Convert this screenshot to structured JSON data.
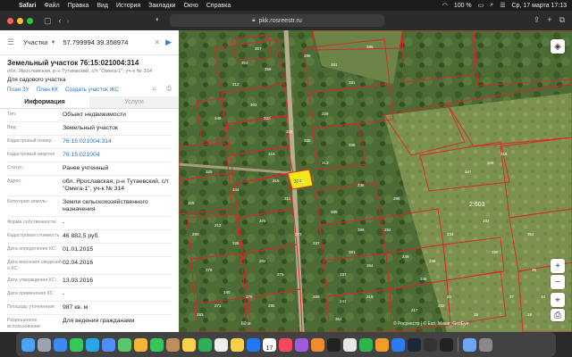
{
  "menubar": {
    "app": "Safari",
    "items": [
      "Файл",
      "Правка",
      "Вид",
      "История",
      "Закладки",
      "Окно",
      "Справка"
    ],
    "battery": "100 %",
    "datetime": "Ср, 17 марта  17:13"
  },
  "browser": {
    "url": "pkk.rosreestr.ru"
  },
  "search": {
    "layer": "Участки",
    "query": "57.799994 39.358974"
  },
  "parcel": {
    "title": "Земельный участок 76:15:021004:314",
    "address_short": "обл. Ярославская, р-н Тутаевский, с/т \"Омега-1\", уч-к № 314",
    "purpose": "Для садового участка",
    "actions": [
      "План ЗУ",
      "План КК",
      "Создать участок ЖС"
    ],
    "tabs": [
      "Информация",
      "Услуги"
    ],
    "rows": [
      {
        "label": "Тип:",
        "value": "Объект недвижимости",
        "link": false
      },
      {
        "label": "Вид:",
        "value": "Земельный участок",
        "link": false
      },
      {
        "label": "Кадастровый номер:",
        "value": "76:15:021004:314",
        "link": true
      },
      {
        "label": "Кадастровый квартал:",
        "value": "76:15:021004",
        "link": true
      },
      {
        "label": "Статус:",
        "value": "Ранее учтенный",
        "link": false
      },
      {
        "label": "Адрес:",
        "value": "обл. Ярославская, р-н Тутаевский, с/т \"Омега-1\", уч-к № 314",
        "link": false
      },
      {
        "label": "Категория земель:",
        "value": "Земли сельскохозяйственного назначения",
        "link": false
      },
      {
        "label": "Форма собственности:",
        "value": "-",
        "link": false
      },
      {
        "label": "Кадастровая стоимость:",
        "value": "46 882,5 руб.",
        "link": false
      },
      {
        "label": "Дата определения КС:",
        "value": "01.01.2015",
        "link": false
      },
      {
        "label": "Дата внесения сведений о КС:",
        "value": "02.04.2016",
        "link": false
      },
      {
        "label": "Дата утверждения КС:",
        "value": "13.03.2016",
        "link": false
      },
      {
        "label": "Дата применения КС:",
        "value": "-",
        "link": false
      },
      {
        "label": "Площадь уточненная:",
        "value": "987 кв. м",
        "link": false
      },
      {
        "label": "Разрешенное использование:",
        "value": "Для ведения гражданами",
        "link": false
      }
    ]
  },
  "map": {
    "highlight_label": "314",
    "big_label": "2:603",
    "parcel_numbers": [
      "354",
      "357",
      "359",
      "312",
      "399",
      "301",
      "395",
      "331",
      "303",
      "322",
      "348",
      "329",
      "339",
      "330",
      "315",
      "314",
      "311",
      "313",
      "315",
      "336",
      "344",
      "325",
      "325",
      "213",
      "325",
      "325",
      "278",
      "282",
      "389",
      "386",
      "381",
      "275",
      "276",
      "271",
      "337",
      "364",
      "285",
      "242",
      "284",
      "249",
      "218",
      "248",
      "217",
      "232",
      "285",
      "236",
      "290",
      "240",
      "273",
      "237",
      "285",
      "283",
      "347",
      "346",
      "315",
      "258",
      "354",
      "37",
      "35",
      "10",
      "19",
      "15",
      "20",
      "235",
      "234",
      "232",
      "351"
    ],
    "attribution": "© Росреестр | © Esri, Maxar, GeoEye",
    "scale": "60 м",
    "controls": [
      "+",
      "−"
    ]
  },
  "colors": {
    "parcel_line": "#e0232b",
    "highlight_fill": "#f4e81a",
    "link": "#2c74c9"
  },
  "dock": {
    "icons": [
      "finder-icon",
      "launchpad-icon",
      "safari-icon",
      "messages-icon",
      "telegram-icon",
      "mail-icon",
      "maps-icon",
      "photos-icon",
      "facetime-icon",
      "contacts-icon",
      "notes-icon",
      "evernote-icon",
      "reminders-icon",
      "notes2-icon",
      "dropbox-icon",
      "calendar-icon",
      "music-icon",
      "podcasts-icon",
      "books-icon",
      "tv-icon",
      "photos2-icon",
      "numbers-icon",
      "pages-icon",
      "keynote-icon",
      "steam-icon",
      "monitor-icon",
      "terminal-icon",
      "downloads-icon",
      "trash-icon"
    ],
    "calendar_day": "17"
  }
}
